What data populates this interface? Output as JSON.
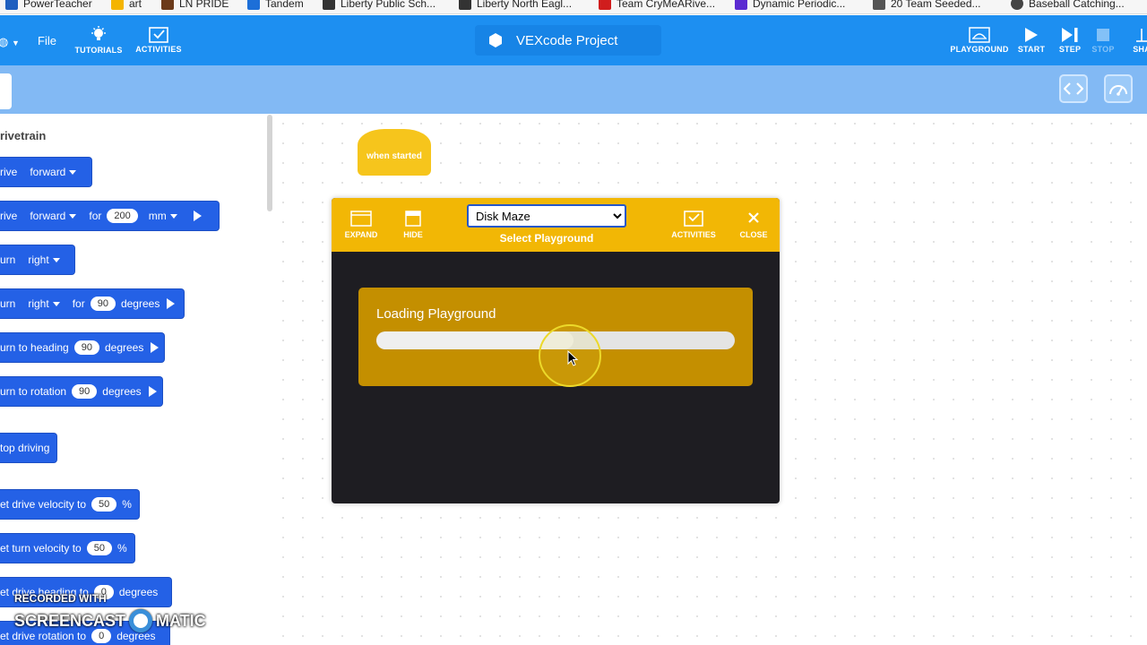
{
  "bookmarks": [
    {
      "label": "PowerTeacher",
      "icon": "powerteacher-icon",
      "color": "#1f5fbf"
    },
    {
      "label": "art",
      "icon": "classroom-icon",
      "color": "#f4b400"
    },
    {
      "label": "LN PRIDE",
      "icon": "mascot-icon",
      "color": "#6b3a1a"
    },
    {
      "label": "Tandem",
      "icon": "tandem-icon",
      "color": "#1d6fd8"
    },
    {
      "label": "Liberty Public Sch...",
      "icon": "district-icon",
      "color": "#333333"
    },
    {
      "label": "Liberty North Eagl...",
      "icon": "gc-icon",
      "color": "#333333"
    },
    {
      "label": "Team CryMeARive...",
      "icon": "team-icon",
      "color": "#d01d1d"
    },
    {
      "label": "Dynamic Periodic...",
      "icon": "ptable-icon",
      "color": "#5b2bd1"
    },
    {
      "label": "20 Team Seeded...",
      "icon": "bracket-icon",
      "color": "#555555"
    },
    {
      "label": "Baseball Catching...",
      "icon": "baseball-icon",
      "color": "#444444"
    }
  ],
  "toolbar": {
    "file": "File",
    "tutorials": "TUTORIALS",
    "activities": "ACTIVITIES",
    "project_name": "VEXcode Project",
    "playground": "PLAYGROUND",
    "start": "START",
    "step": "STEP",
    "stop": "STOP",
    "share": "SHA"
  },
  "palette": {
    "category": "rivetrain",
    "blocks": [
      {
        "parts": [
          "rive",
          "forward"
        ]
      },
      {
        "parts": [
          "rive",
          "forward",
          "for",
          "200",
          "mm"
        ]
      },
      {
        "parts": [
          "urn",
          "right"
        ]
      },
      {
        "parts": [
          "urn",
          "right",
          "for",
          "90",
          "degrees"
        ]
      },
      {
        "parts": [
          "urn to heading",
          "90",
          "degrees"
        ]
      },
      {
        "parts": [
          "urn to rotation",
          "90",
          "degrees"
        ]
      },
      {
        "parts": [
          "top driving"
        ]
      },
      {
        "parts": [
          "et drive velocity to",
          "50",
          "%"
        ]
      },
      {
        "parts": [
          "et turn velocity to",
          "50",
          "%"
        ]
      },
      {
        "parts": [
          "et drive heading to",
          "0",
          "degrees"
        ]
      },
      {
        "parts": [
          "et drive rotation to",
          "0",
          "degrees"
        ]
      }
    ]
  },
  "workspace": {
    "hat_block": "when started"
  },
  "playground": {
    "expand": "EXPAND",
    "hide": "HIDE",
    "selected": "Disk Maze",
    "select_label": "Select Playground",
    "activities": "ACTIVITIES",
    "close": "CLOSE",
    "loading_text": "Loading Playground",
    "progress": 0.55
  },
  "watermark": {
    "line1": "RECORDED WITH",
    "line2a": "SCREENCAST",
    "line2b": "MATIC"
  },
  "colors": {
    "toolbar": "#1d8ff1",
    "subbar": "#82b9f4",
    "block": "#2461e6",
    "playground_header": "#f2b705",
    "loading_card": "#c48f00"
  }
}
